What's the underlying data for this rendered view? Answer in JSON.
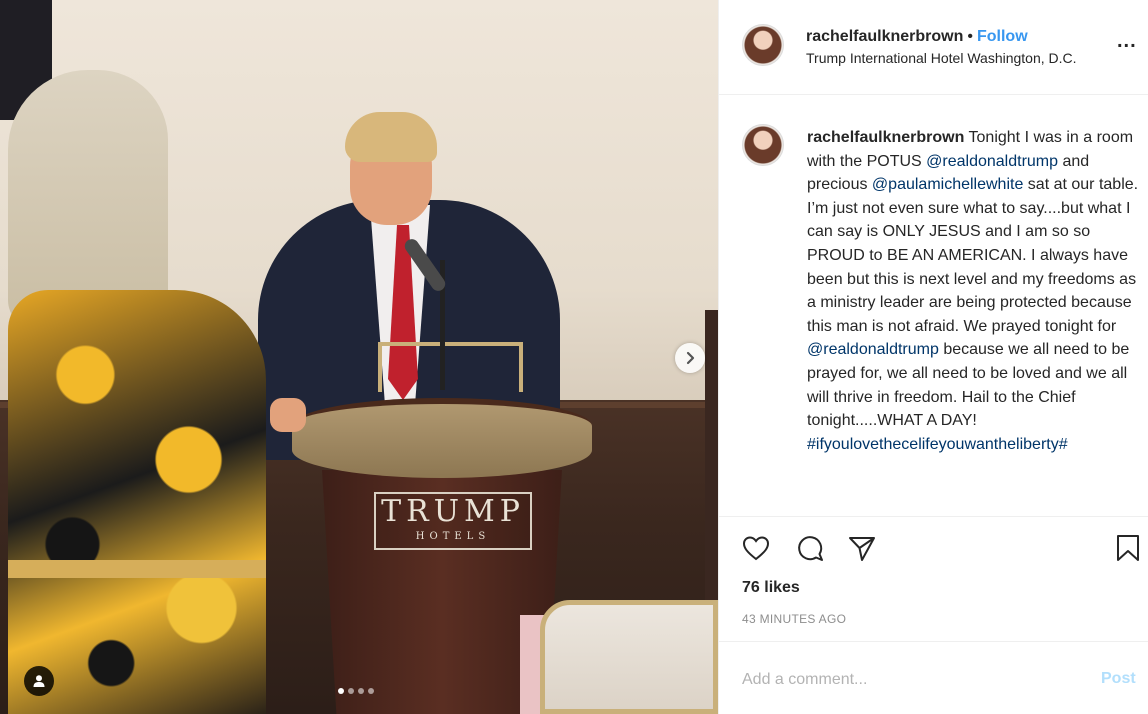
{
  "post": {
    "username": "rachelfaulknerbrown",
    "separator": "•",
    "follow_label": "Follow",
    "location": "Trump International Hotel Washington, D.C.",
    "more_label": "...",
    "podium_sign": {
      "line1": "TRUMP",
      "line2": "HOTELS"
    }
  },
  "caption": {
    "username": "rachelfaulknerbrown",
    "part1": " Tonight I was in a room with the POTUS ",
    "mention1": "@realdonaldtrump",
    "part2": " and precious ",
    "mention2": "@paulamichellewhite",
    "part3": " sat at our table. I’m just not even sure what to say....but what I can say is ONLY JESUS and I am so so PROUD to BE AN AMERICAN. I always have been but this is next level and my freedoms as a ministry leader are being protected because this man is not afraid. We prayed tonight for ",
    "mention3": "@realdonaldtrump",
    "part4": " because we all need to be prayed for, we all need to be loved and we all will thrive in freedom. Hail to the Chief tonight.....WHAT A DAY!",
    "hashtags": "#ifyoulovethecelifeyouwantheliberty#"
  },
  "engagement": {
    "likes": "76 likes",
    "time": "43 MINUTES AGO"
  },
  "comment": {
    "placeholder": "Add a comment...",
    "post_label": "Post"
  },
  "carousel": {
    "slide_count": 4,
    "active_index": 0
  },
  "colors": {
    "accent": "#3897f0",
    "mention": "#003569",
    "muted": "#8e8e8e",
    "post_disabled": "#b2dffc"
  },
  "icons": [
    "heart-icon",
    "comment-icon",
    "share-icon",
    "bookmark-icon",
    "chevron-right-icon",
    "user-tag-icon",
    "more-icon"
  ]
}
